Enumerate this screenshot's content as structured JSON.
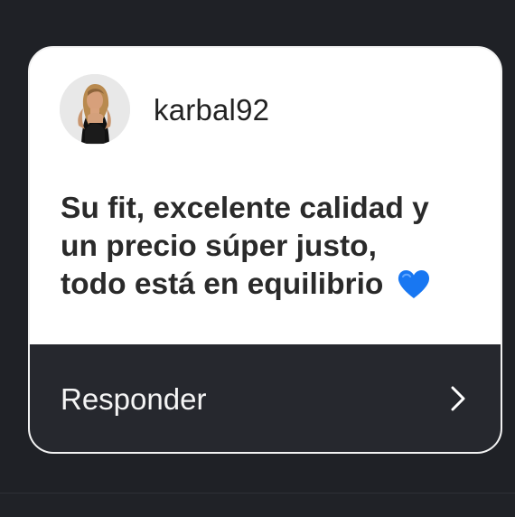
{
  "story_reply_card": {
    "username": "karbal92",
    "avatar_alt": "karbal92",
    "message_lines": [
      "Su fit, excelente calidad y",
      "un precio súper justo,",
      "todo está en equilibrio"
    ],
    "emoji": "blue-heart-icon",
    "reply_label": "Responder",
    "reply_chevron": "chevron-right-icon"
  },
  "colors": {
    "page_background": "#1f2126",
    "card_background": "#ffffff",
    "card_border": "#f2f2f2",
    "footer_background": "#26282e",
    "heart": "#1877f2"
  }
}
